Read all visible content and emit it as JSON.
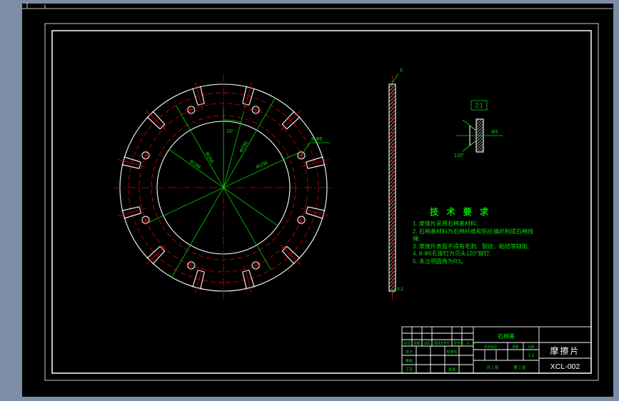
{
  "colors": {
    "canvas_bg": "#7b8ea6",
    "paper_bg": "#000000",
    "outline": "#ffffff",
    "centerline": "#dd0000",
    "dimension": "#00d400"
  },
  "front_view": {
    "labels": {
      "d1": "Φ290",
      "d2": "Φ266",
      "d3": "Φ236",
      "d4": "Φ186",
      "holes": "8-Φ5",
      "angle": "15°"
    }
  },
  "side_view": {
    "labels": {
      "thickness": "5",
      "roughness": "3.2"
    }
  },
  "detail_view": {
    "labels": {
      "scale": "2:1",
      "dia": "Φ5",
      "angle": "120°"
    }
  },
  "tech_req": {
    "title": "技 术 要 求",
    "items": [
      "1. 摩擦片采用石棉基材料;",
      "2. 石棉基材料为石棉纤维和铜丝编织制成石棉线绳;",
      "3. 摩擦片表面不得有毛刺、裂纹、粘结等缺陷;",
      "4. 8-Φ5孔铆钉为沉头120°铆钉;",
      "5. 未注明圆角为R3。"
    ]
  },
  "title_block": {
    "material": "石棉基",
    "part_name": "摩擦片",
    "drawing_no": "XCL-002",
    "rev_headers": {
      "mark": "标记",
      "count": "处数",
      "zone": "分区",
      "doc": "更改文件号",
      "sign": "签字",
      "date": "年、月、日"
    },
    "roles": {
      "design": "设计",
      "standard": "标准化",
      "audit": "审核",
      "process": "工艺",
      "approve": "批准"
    },
    "cols": {
      "stage": "阶段标记",
      "mass": "质量",
      "scale": "比例"
    },
    "scale_value": "1:1",
    "sheet_total": "共 1 张",
    "sheet_no": "第 1 张"
  }
}
